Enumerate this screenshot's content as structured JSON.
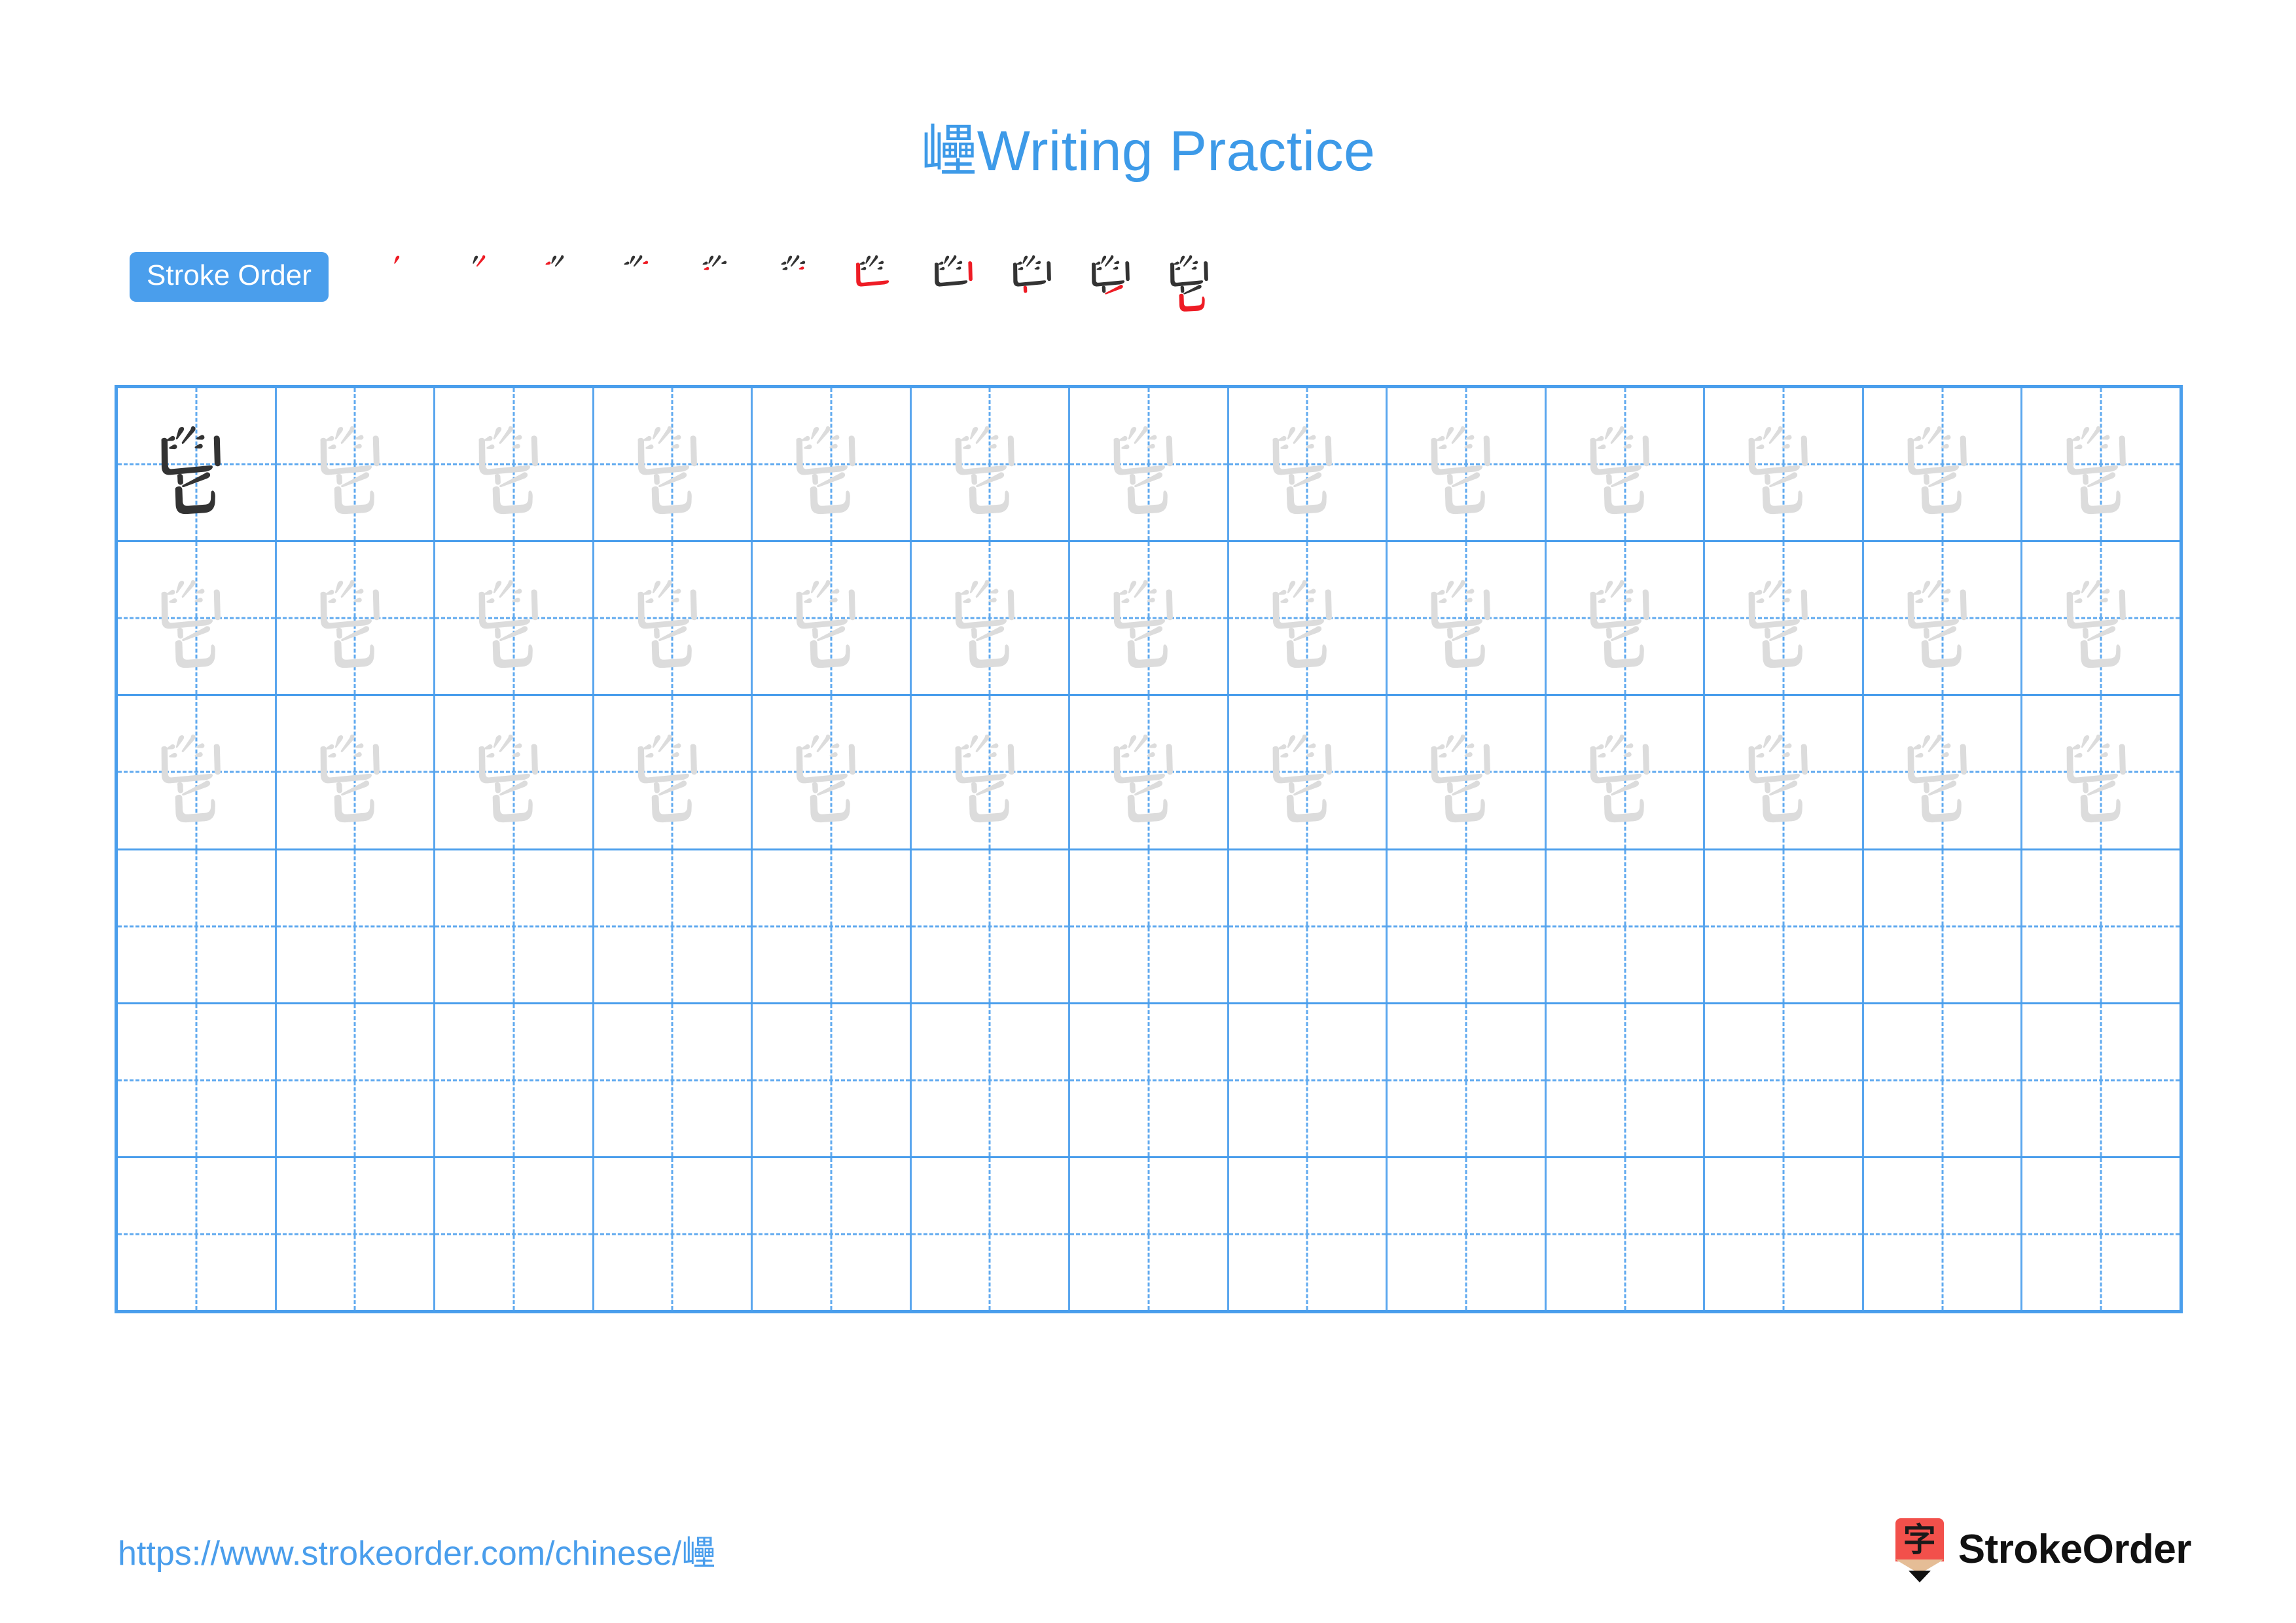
{
  "character": "㠥",
  "title": {
    "character": "㠥",
    "text": " Writing Practice",
    "color": "#3d9ae8"
  },
  "stroke_order": {
    "badge_label": "Stroke Order",
    "badge_color": "#4a9eec",
    "new_stroke_color": "#ee1c25",
    "existing_stroke_color": "#333333",
    "total_strokes": 11,
    "steps": [
      {
        "index": 1,
        "strokes_shown": 1
      },
      {
        "index": 2,
        "strokes_shown": 2
      },
      {
        "index": 3,
        "strokes_shown": 3
      },
      {
        "index": 4,
        "strokes_shown": 4
      },
      {
        "index": 5,
        "strokes_shown": 5
      },
      {
        "index": 6,
        "strokes_shown": 6
      },
      {
        "index": 7,
        "strokes_shown": 7
      },
      {
        "index": 8,
        "strokes_shown": 8
      },
      {
        "index": 9,
        "strokes_shown": 9
      },
      {
        "index": 10,
        "strokes_shown": 10
      },
      {
        "index": 11,
        "strokes_shown": 11
      }
    ]
  },
  "grid": {
    "columns": 13,
    "rows": 6,
    "line_color": "#4a9eec",
    "guide_color": "#60aaef",
    "traced_rows": 3,
    "empty_rows": 3,
    "model_char_color": "#333333",
    "trace_char_color": "#dcdcdc"
  },
  "footer": {
    "url": "https://www.strokeorder.com/chinese/㠥",
    "url_color": "#4a9eec",
    "logo_char": "字",
    "logo_text": "StrokeOrder",
    "logo_color": "#f2504b"
  }
}
